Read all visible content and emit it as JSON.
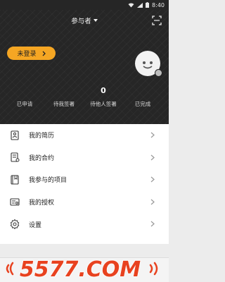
{
  "status_bar": {
    "time": "8:40"
  },
  "header": {
    "role_label": "参与者",
    "login_button_label": "未登录"
  },
  "stats": [
    {
      "count": "",
      "label": "已申请"
    },
    {
      "count": "",
      "label": "待我签署"
    },
    {
      "count": "0",
      "label": "待他人签署"
    },
    {
      "count": "",
      "label": "已完成"
    }
  ],
  "menu": [
    {
      "label": "我的简历",
      "icon": "resume-icon"
    },
    {
      "label": "我的合约",
      "icon": "contract-icon"
    },
    {
      "label": "我参与的项目",
      "icon": "book-icon"
    },
    {
      "label": "我的授权",
      "icon": "certificate-icon"
    },
    {
      "label": "设置",
      "icon": "gear-icon"
    }
  ],
  "watermark": {
    "text": "5577.COM",
    "color": "#e8421f"
  },
  "colors": {
    "header_bg": "#262626",
    "accent": "#f5a623"
  }
}
